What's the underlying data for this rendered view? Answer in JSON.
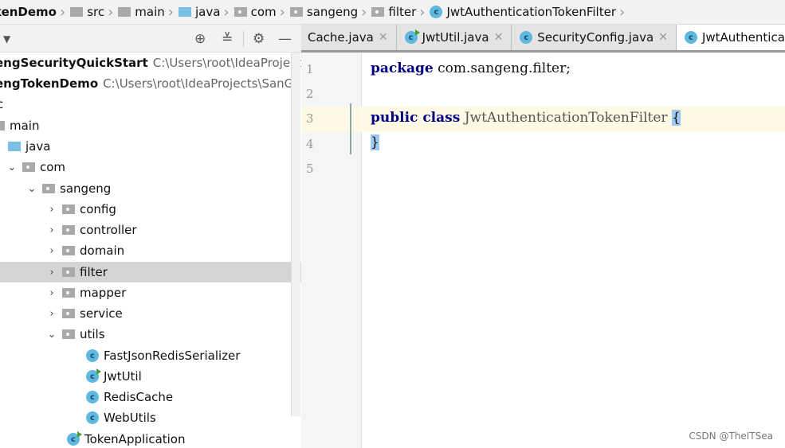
{
  "breadcrumb": [
    "kenDemo",
    "src",
    "main",
    "java",
    "com",
    "sangeng",
    "filter",
    "JwtAuthenticationTokenFilter"
  ],
  "tree": [
    {
      "label": "engSecurityQuickStart",
      "path": "C:\\Users\\root\\IdeaProjects\\S",
      "bold": true
    },
    {
      "label": "engTokenDemo",
      "path": "C:\\Users\\root\\IdeaProjects\\SanGen",
      "bold": true
    },
    {
      "label": "c"
    },
    {
      "label": "main"
    },
    {
      "label": "java"
    },
    {
      "label": "com"
    },
    {
      "label": "sangeng"
    },
    {
      "label": "config"
    },
    {
      "label": "controller"
    },
    {
      "label": "domain"
    },
    {
      "label": "filter",
      "selected": true
    },
    {
      "label": "mapper"
    },
    {
      "label": "service"
    },
    {
      "label": "utils"
    },
    {
      "label": "FastJsonRedisSerializer"
    },
    {
      "label": "JwtUtil"
    },
    {
      "label": "RedisCache"
    },
    {
      "label": "WebUtils"
    },
    {
      "label": "TokenApplication"
    }
  ],
  "tabs": [
    "Cache.java",
    "JwtUtil.java",
    "SecurityConfig.java",
    "JwtAuthenticationT"
  ],
  "class_icon_letter": "c",
  "code": {
    "line_numbers": [
      "1",
      "2",
      "3",
      "4",
      "5"
    ],
    "l1_kw": "package",
    "l1_rest": " com.sangeng.filter;",
    "l3_kw": "public class",
    "l3_name": " JwtAuthenticationTokenFilter ",
    "open_brace": "{",
    "close_brace": "}"
  },
  "watermark": "CSDN @TheITSea",
  "colors": {
    "keyword": "#000080",
    "selection": "#d5d5d5",
    "caret_line": "#fdf9e4",
    "class_icon": "#5fb8de"
  }
}
